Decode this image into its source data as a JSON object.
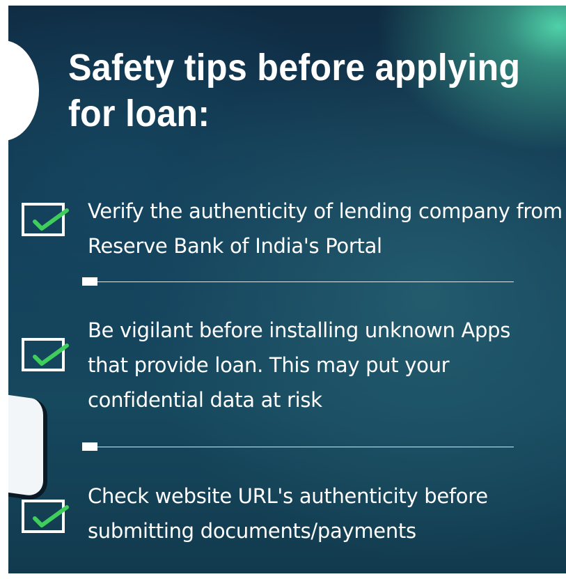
{
  "title": "Safety tips before applying for loan:",
  "tips": [
    {
      "text": "Verify the authenticity of lending company from Reserve Bank of India's Portal"
    },
    {
      "text": "Be vigilant before  installing unknown Apps that provide loan. This may put your confidential data at risk"
    },
    {
      "text": "Check website URL's authenticity before submitting documents/payments"
    }
  ],
  "colors": {
    "checkmark": "#3fce5c",
    "text": "#ffffff",
    "background_dark": "#0f2b42",
    "glow": "#4fd1a8"
  },
  "icons": [
    "checkbox-checked-icon",
    "divider-marker"
  ]
}
